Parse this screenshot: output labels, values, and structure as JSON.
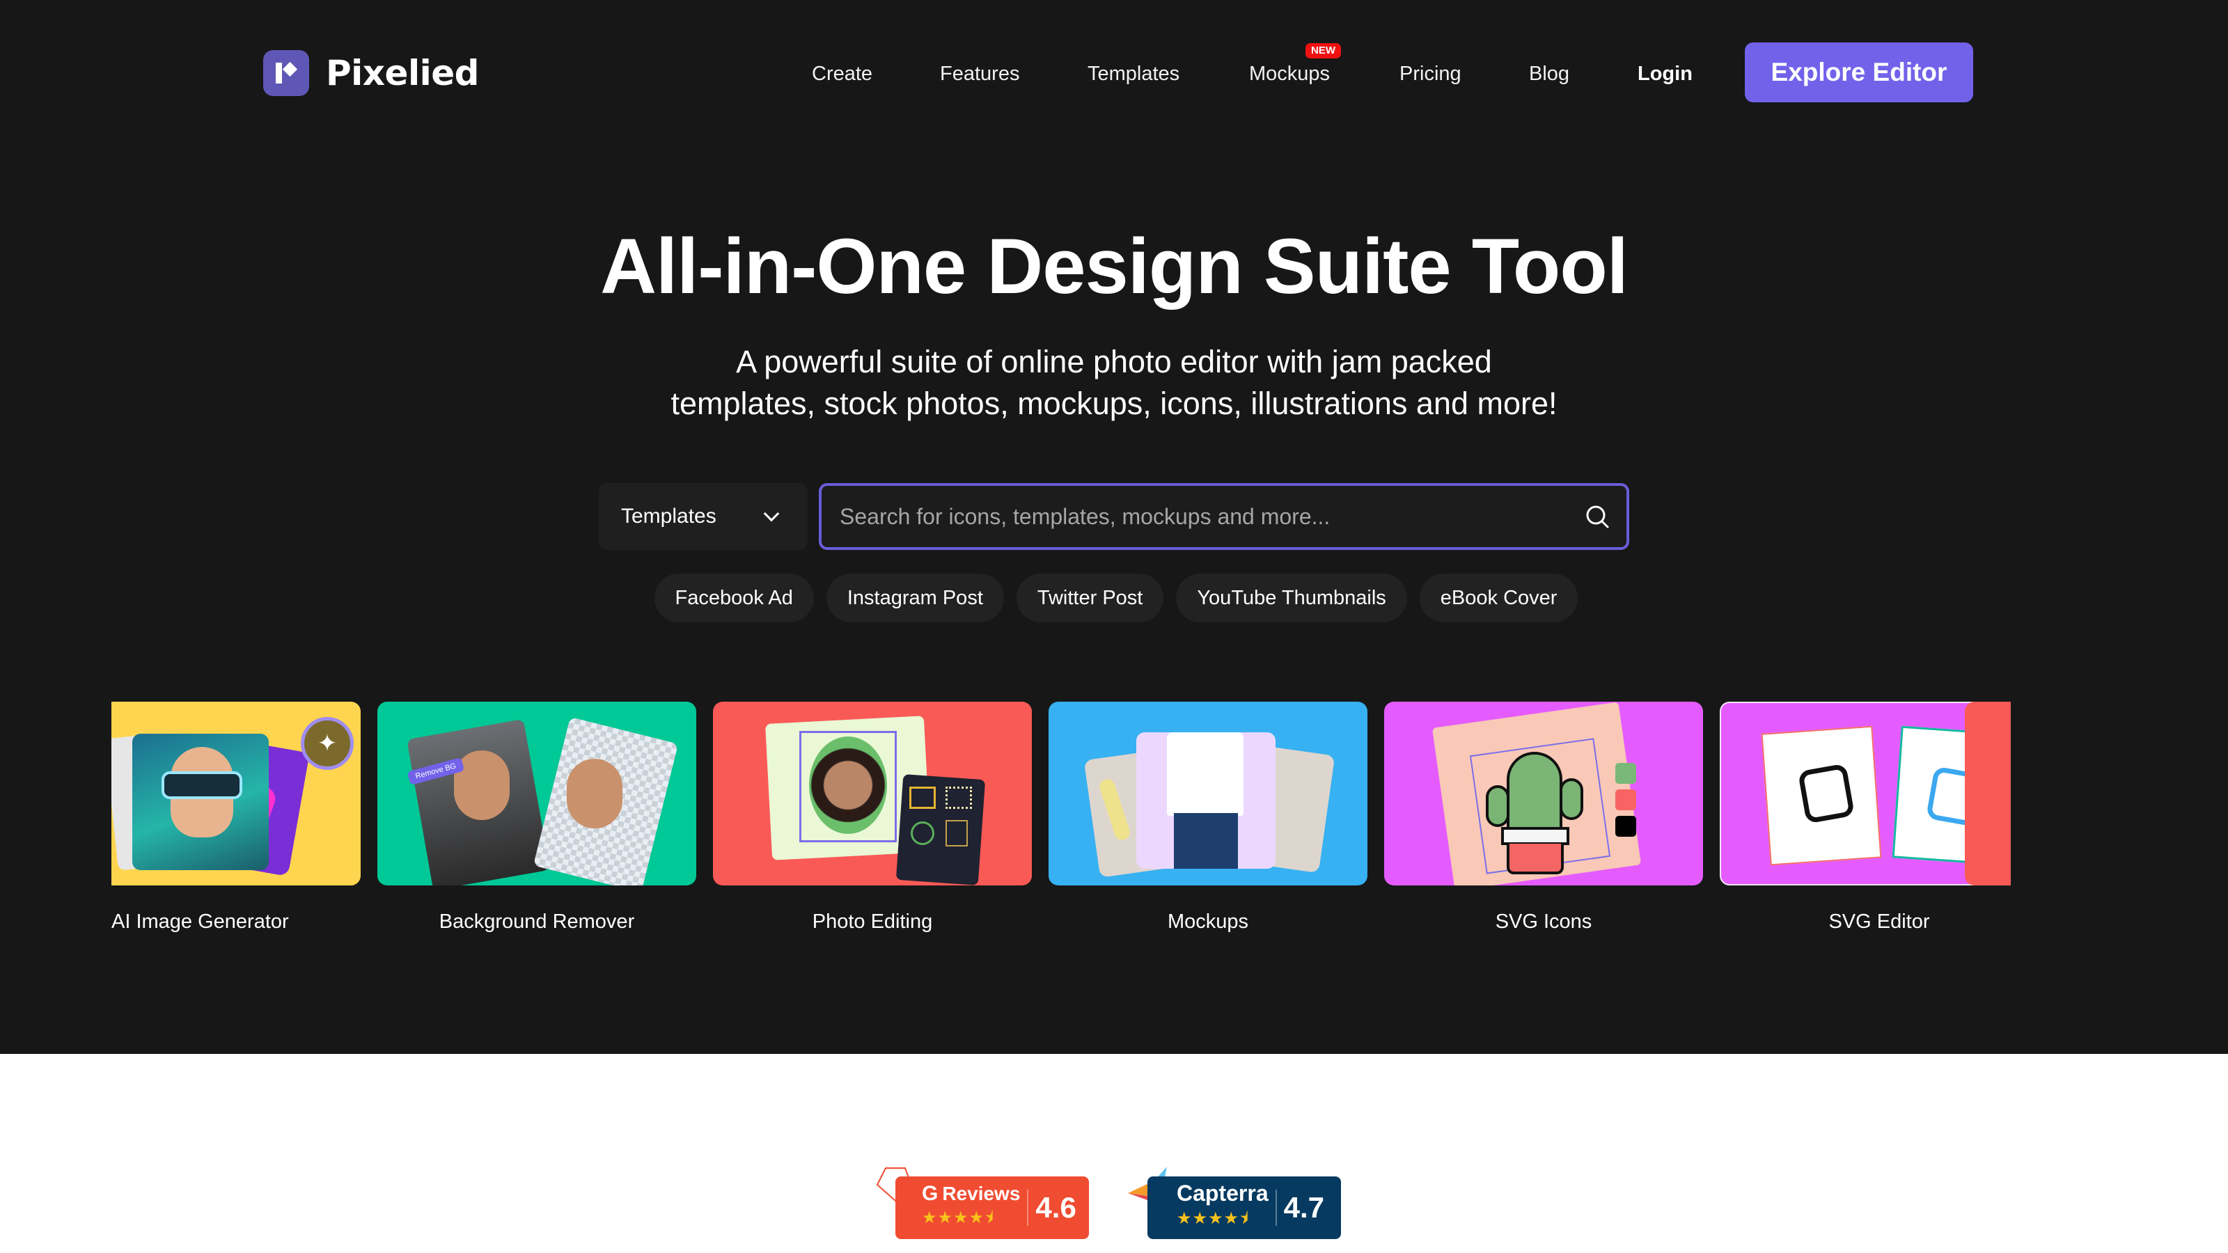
{
  "brand": {
    "name": "Pixelied",
    "accent": "#7262ea"
  },
  "nav": {
    "items": [
      {
        "label": "Create"
      },
      {
        "label": "Features"
      },
      {
        "label": "Templates"
      },
      {
        "label": "Mockups",
        "badge": "NEW"
      },
      {
        "label": "Pricing"
      },
      {
        "label": "Blog"
      }
    ],
    "login": "Login",
    "cta": "Explore Editor"
  },
  "hero": {
    "title": "All-in-One Design Suite Tool",
    "subtitle_line1": "A powerful suite of online photo editor with jam packed",
    "subtitle_line2": "templates, stock photos, mockups, icons, illustrations and more!"
  },
  "search": {
    "category": "Templates",
    "placeholder": "Search for icons, templates, mockups and more...",
    "value": ""
  },
  "chips": [
    "Facebook Ad",
    "Instagram Post",
    "Twitter Post",
    "YouTube Thumbnails",
    "eBook Cover"
  ],
  "cards": [
    {
      "label": "AI Image Generator",
      "color": "#ffd54f",
      "icon": "magic-wand-icon"
    },
    {
      "label": "Background Remover",
      "color": "#00c896",
      "tag": "Remove BG"
    },
    {
      "label": "Photo Editing",
      "color": "#fa5a56"
    },
    {
      "label": "Mockups",
      "color": "#37b1f2"
    },
    {
      "label": "SVG Icons",
      "color": "#e45cff"
    },
    {
      "label": "SVG Editor",
      "color": "#e45cff",
      "icon": "pencil-icon"
    },
    {
      "label": "",
      "color": "#fa5a56"
    }
  ],
  "ratings": [
    {
      "name": "Reviews",
      "brand": "G2",
      "score": "4.6",
      "stars": "★★★★⯨",
      "color": "#f04c32"
    },
    {
      "name": "Capterra",
      "brand": "Capterra",
      "score": "4.7",
      "stars": "★★★★⯨",
      "color": "#073a60"
    }
  ]
}
